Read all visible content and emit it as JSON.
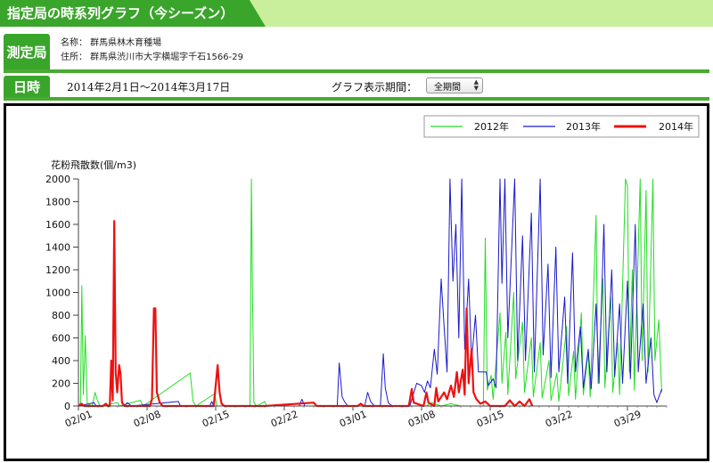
{
  "header": {
    "title": "指定局の時系列グラフ（今シーズン）"
  },
  "station": {
    "label": "測定局",
    "name": "名称： 群馬県林木育種場",
    "address": "住所： 群馬県渋川市大字横堀字千石1566-29"
  },
  "datetime": {
    "label": "日時",
    "range": "2014年2月1日～2014年3月17日",
    "period_label": "グラフ表示期間：",
    "period_value": "全期間"
  },
  "chart_data": {
    "type": "line",
    "ylabel": "花粉飛散数(個/m3)",
    "ylim": [
      0,
      2000
    ],
    "yticks": [
      0,
      200,
      400,
      600,
      800,
      1000,
      1200,
      1400,
      1600,
      1800,
      2000
    ],
    "x_start": "02/01",
    "x_end": "04/04",
    "x_unit": "days",
    "xtick_labels": [
      "02/01",
      "02/08",
      "02/15",
      "02/22",
      "03/01",
      "03/08",
      "03/15",
      "03/22",
      "03/29"
    ],
    "xtick_days": [
      0,
      7,
      14,
      21,
      28,
      35,
      42,
      49,
      56
    ],
    "series": [
      {
        "name": "2012年",
        "color": "#22dd22",
        "points": [
          [
            0.2,
            0
          ],
          [
            0.35,
            1060
          ],
          [
            0.5,
            100
          ],
          [
            0.7,
            620
          ],
          [
            0.9,
            20
          ],
          [
            1.4,
            0
          ],
          [
            1.7,
            120
          ],
          [
            1.9,
            60
          ],
          [
            2.2,
            0
          ],
          [
            4.0,
            30
          ],
          [
            4.2,
            0
          ],
          [
            6.3,
            50
          ],
          [
            6.6,
            0
          ],
          [
            11.4,
            290
          ],
          [
            11.7,
            40
          ],
          [
            12.0,
            0
          ],
          [
            13.9,
            110
          ],
          [
            14.1,
            0
          ],
          [
            17.5,
            0
          ],
          [
            17.65,
            2000
          ],
          [
            17.75,
            1000
          ],
          [
            17.9,
            30
          ],
          [
            18.2,
            0
          ],
          [
            19.0,
            40
          ],
          [
            19.2,
            0
          ],
          [
            35.5,
            0
          ],
          [
            36.0,
            30
          ],
          [
            37.0,
            0
          ],
          [
            38.0,
            20
          ],
          [
            39.0,
            0
          ],
          [
            41.3,
            0
          ],
          [
            41.5,
            1480
          ],
          [
            41.7,
            140
          ],
          [
            42.1,
            270
          ],
          [
            42.3,
            60
          ],
          [
            43.0,
            820
          ],
          [
            43.2,
            200
          ],
          [
            43.6,
            650
          ],
          [
            43.8,
            100
          ],
          [
            44.4,
            1000
          ],
          [
            44.6,
            240
          ],
          [
            45.3,
            740
          ],
          [
            45.5,
            120
          ],
          [
            46.2,
            600
          ],
          [
            46.4,
            80
          ],
          [
            47.1,
            560
          ],
          [
            47.3,
            70
          ],
          [
            48.0,
            400
          ],
          [
            48.2,
            50
          ],
          [
            48.8,
            290
          ],
          [
            49.0,
            40
          ],
          [
            49.8,
            700
          ],
          [
            50.0,
            90
          ],
          [
            50.5,
            480
          ],
          [
            50.7,
            60
          ],
          [
            51.3,
            820
          ],
          [
            51.5,
            100
          ],
          [
            52.0,
            480
          ],
          [
            52.2,
            80
          ],
          [
            52.8,
            1680
          ],
          [
            53.0,
            200
          ],
          [
            53.5,
            1120
          ],
          [
            53.7,
            160
          ],
          [
            54.3,
            960
          ],
          [
            54.5,
            120
          ],
          [
            55.0,
            560
          ],
          [
            55.2,
            100
          ],
          [
            55.8,
            2000
          ],
          [
            56.0,
            1940
          ],
          [
            56.2,
            300
          ],
          [
            56.5,
            1200
          ],
          [
            56.7,
            140
          ],
          [
            57.3,
            2000
          ],
          [
            57.5,
            400
          ],
          [
            57.9,
            1900
          ],
          [
            58.1,
            300
          ],
          [
            58.6,
            2000
          ],
          [
            58.8,
            400
          ],
          [
            59.2,
            760
          ],
          [
            59.5,
            120
          ]
        ]
      },
      {
        "name": "2013年",
        "color": "#1a1acc",
        "points": [
          [
            0,
            0
          ],
          [
            1.6,
            30
          ],
          [
            1.8,
            0
          ],
          [
            4.6,
            0
          ],
          [
            5.0,
            30
          ],
          [
            5.4,
            0
          ],
          [
            10.2,
            40
          ],
          [
            10.4,
            0
          ],
          [
            13.4,
            0
          ],
          [
            13.6,
            40
          ],
          [
            13.8,
            0
          ],
          [
            22.5,
            0
          ],
          [
            22.8,
            60
          ],
          [
            23.1,
            0
          ],
          [
            26.4,
            0
          ],
          [
            26.6,
            380
          ],
          [
            26.9,
            80
          ],
          [
            27.2,
            30
          ],
          [
            27.5,
            0
          ],
          [
            29.2,
            0
          ],
          [
            29.5,
            120
          ],
          [
            29.8,
            40
          ],
          [
            30.2,
            0
          ],
          [
            30.8,
            0
          ],
          [
            31.1,
            460
          ],
          [
            31.3,
            160
          ],
          [
            31.6,
            30
          ],
          [
            32.0,
            0
          ],
          [
            33.8,
            0
          ],
          [
            34.5,
            200
          ],
          [
            35.0,
            180
          ],
          [
            35.3,
            120
          ],
          [
            35.6,
            220
          ],
          [
            35.9,
            160
          ],
          [
            36.3,
            500
          ],
          [
            36.6,
            280
          ],
          [
            37.0,
            1120
          ],
          [
            37.3,
            700
          ],
          [
            37.6,
            300
          ],
          [
            37.9,
            2000
          ],
          [
            38.2,
            1100
          ],
          [
            38.5,
            1600
          ],
          [
            38.8,
            600
          ],
          [
            39.1,
            2000
          ],
          [
            39.4,
            500
          ],
          [
            39.8,
            1120
          ],
          [
            40.1,
            400
          ],
          [
            40.5,
            800
          ],
          [
            40.8,
            300
          ],
          [
            41.2,
            300
          ],
          [
            41.6,
            300
          ],
          [
            41.8,
            180
          ],
          [
            42.3,
            240
          ],
          [
            42.6,
            160
          ],
          [
            43.0,
            2000
          ],
          [
            43.2,
            1080
          ],
          [
            43.5,
            2000
          ],
          [
            43.8,
            600
          ],
          [
            44.5,
            2000
          ],
          [
            44.8,
            400
          ],
          [
            45.3,
            1500
          ],
          [
            45.6,
            400
          ],
          [
            46.2,
            1700
          ],
          [
            46.5,
            300
          ],
          [
            47.1,
            2000
          ],
          [
            47.4,
            450
          ],
          [
            47.9,
            1250
          ],
          [
            48.2,
            250
          ],
          [
            48.7,
            1400
          ],
          [
            49.0,
            300
          ],
          [
            49.6,
            960
          ],
          [
            49.9,
            200
          ],
          [
            50.4,
            1350
          ],
          [
            50.7,
            300
          ],
          [
            51.2,
            700
          ],
          [
            51.5,
            160
          ],
          [
            52.0,
            500
          ],
          [
            52.3,
            150
          ],
          [
            52.8,
            900
          ],
          [
            53.1,
            200
          ],
          [
            53.6,
            1600
          ],
          [
            53.9,
            300
          ],
          [
            54.4,
            1200
          ],
          [
            54.7,
            260
          ],
          [
            55.2,
            900
          ],
          [
            55.5,
            200
          ],
          [
            56.0,
            1100
          ],
          [
            56.3,
            240
          ],
          [
            56.8,
            1600
          ],
          [
            57.1,
            300
          ],
          [
            57.6,
            900
          ],
          [
            57.9,
            200
          ],
          [
            58.4,
            600
          ],
          [
            58.7,
            100
          ],
          [
            59.0,
            30
          ],
          [
            59.5,
            150
          ]
        ]
      },
      {
        "name": "2014年",
        "color": "#ee1111",
        "points": [
          [
            0,
            0
          ],
          [
            0.3,
            20
          ],
          [
            0.6,
            0
          ],
          [
            2.5,
            0
          ],
          [
            2.8,
            20
          ],
          [
            3.0,
            0
          ],
          [
            3.2,
            0
          ],
          [
            3.35,
            400
          ],
          [
            3.5,
            50
          ],
          [
            3.65,
            1630
          ],
          [
            3.8,
            300
          ],
          [
            3.95,
            120
          ],
          [
            4.15,
            360
          ],
          [
            4.3,
            280
          ],
          [
            4.45,
            30
          ],
          [
            4.7,
            0
          ],
          [
            7.3,
            0
          ],
          [
            7.5,
            60
          ],
          [
            7.7,
            860
          ],
          [
            7.85,
            860
          ],
          [
            8.0,
            120
          ],
          [
            8.3,
            30
          ],
          [
            8.6,
            0
          ],
          [
            13.8,
            0
          ],
          [
            14.0,
            180
          ],
          [
            14.2,
            360
          ],
          [
            14.4,
            120
          ],
          [
            14.6,
            20
          ],
          [
            14.9,
            0
          ],
          [
            19.0,
            0
          ],
          [
            24.0,
            30
          ],
          [
            24.3,
            0
          ],
          [
            28.5,
            0
          ],
          [
            28.8,
            20
          ],
          [
            29.1,
            0
          ],
          [
            33.7,
            0
          ],
          [
            34.0,
            150
          ],
          [
            34.2,
            30
          ],
          [
            35.2,
            0
          ],
          [
            35.5,
            120
          ],
          [
            35.7,
            30
          ],
          [
            36.3,
            0
          ],
          [
            36.5,
            160
          ],
          [
            36.7,
            40
          ],
          [
            37.3,
            120
          ],
          [
            37.6,
            60
          ],
          [
            38.0,
            180
          ],
          [
            38.3,
            80
          ],
          [
            38.6,
            300
          ],
          [
            38.8,
            120
          ],
          [
            39.2,
            320
          ],
          [
            39.4,
            100
          ],
          [
            39.6,
            860
          ],
          [
            39.8,
            200
          ],
          [
            40.1,
            500
          ],
          [
            40.3,
            120
          ],
          [
            40.6,
            60
          ],
          [
            41.0,
            20
          ],
          [
            41.5,
            40
          ],
          [
            42.0,
            0
          ],
          [
            43.5,
            0
          ],
          [
            44.0,
            50
          ],
          [
            44.5,
            0
          ],
          [
            45.0,
            40
          ],
          [
            45.5,
            0
          ],
          [
            46.0,
            60
          ],
          [
            46.3,
            0
          ]
        ]
      }
    ]
  }
}
